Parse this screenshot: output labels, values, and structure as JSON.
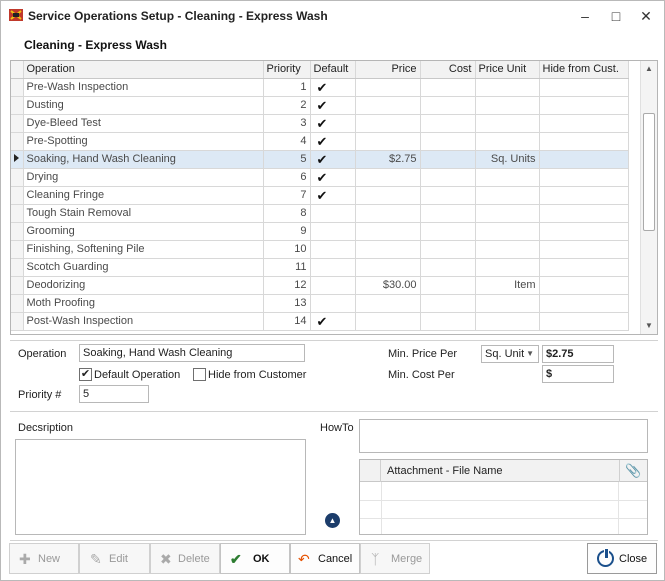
{
  "window": {
    "title": "Service Operations  Setup - Cleaning - Express Wash",
    "subtitle": "Cleaning - Express Wash"
  },
  "grid": {
    "columns": [
      "Operation",
      "Priority",
      "Default",
      "Price",
      "Cost",
      "Price Unit",
      "Hide from Cust."
    ],
    "rows": [
      {
        "operation": "Pre-Wash Inspection",
        "priority": "1",
        "default": "✔",
        "price": "",
        "cost": "",
        "unit": "",
        "hide": ""
      },
      {
        "operation": "Dusting",
        "priority": "2",
        "default": "✔",
        "price": "",
        "cost": "",
        "unit": "",
        "hide": ""
      },
      {
        "operation": "Dye-Bleed Test",
        "priority": "3",
        "default": "✔",
        "price": "",
        "cost": "",
        "unit": "",
        "hide": ""
      },
      {
        "operation": "Pre-Spotting",
        "priority": "4",
        "default": "✔",
        "price": "",
        "cost": "",
        "unit": "",
        "hide": ""
      },
      {
        "operation": "Soaking, Hand Wash Cleaning",
        "priority": "5",
        "default": "✔",
        "price": "$2.75",
        "cost": "",
        "unit": "Sq. Units",
        "hide": ""
      },
      {
        "operation": "Drying",
        "priority": "6",
        "default": "✔",
        "price": "",
        "cost": "",
        "unit": "",
        "hide": ""
      },
      {
        "operation": "Cleaning Fringe",
        "priority": "7",
        "default": "✔",
        "price": "",
        "cost": "",
        "unit": "",
        "hide": ""
      },
      {
        "operation": "Tough Stain Removal",
        "priority": "8",
        "default": "",
        "price": "",
        "cost": "",
        "unit": "",
        "hide": ""
      },
      {
        "operation": "Grooming",
        "priority": "9",
        "default": "",
        "price": "",
        "cost": "",
        "unit": "",
        "hide": ""
      },
      {
        "operation": "Finishing, Softening Pile",
        "priority": "10",
        "default": "",
        "price": "",
        "cost": "",
        "unit": "",
        "hide": ""
      },
      {
        "operation": "Scotch Guarding",
        "priority": "11",
        "default": "",
        "price": "",
        "cost": "",
        "unit": "",
        "hide": ""
      },
      {
        "operation": "Deodorizing",
        "priority": "12",
        "default": "",
        "price": "$30.00",
        "cost": "",
        "unit": "Item",
        "hide": ""
      },
      {
        "operation": "Moth Proofing",
        "priority": "13",
        "default": "",
        "price": "",
        "cost": "",
        "unit": "",
        "hide": ""
      },
      {
        "operation": "Post-Wash Inspection",
        "priority": "14",
        "default": "✔",
        "price": "",
        "cost": "",
        "unit": "",
        "hide": ""
      }
    ],
    "selected_index": 4
  },
  "form": {
    "operation_label": "Operation",
    "operation_value": "Soaking, Hand Wash Cleaning",
    "default_op_label": "Default Operation",
    "default_op_checked": "✔",
    "hide_customer_label": "Hide from Customer",
    "priority_label": "Priority #",
    "priority_value": "5",
    "min_price_label": "Min. Price Per",
    "price_unit_value": "Sq. Unit",
    "min_price_value": "$2.75",
    "min_cost_label": "Min. Cost Per",
    "min_cost_value": "$",
    "description_label": "Decsription",
    "howto_label": "HowTo",
    "attachment_header": "Attachment - File Name"
  },
  "toolbar": {
    "new_label": "New",
    "edit_label": "Edit",
    "delete_label": "Delete",
    "ok_label": "OK",
    "cancel_label": "Cancel",
    "merge_label": "Merge",
    "close_label": "Close"
  }
}
